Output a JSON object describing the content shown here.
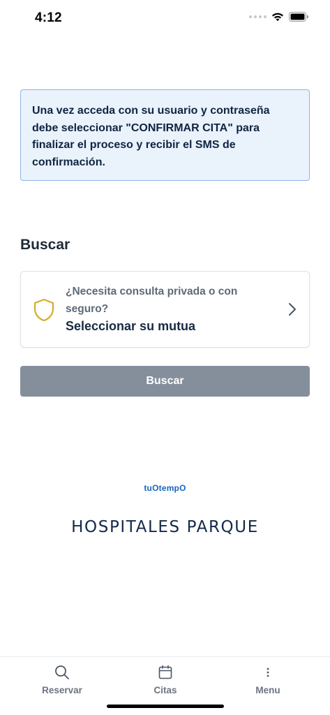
{
  "status_bar": {
    "time": "4:12"
  },
  "notice": {
    "text": "Una vez acceda con su usuario y contraseña debe seleccionar \"CONFIRMAR CITA\" para finalizar el proceso y recibir el SMS de confirmación."
  },
  "search": {
    "title": "Buscar",
    "insurance_card": {
      "question": "¿Necesita consulta privada o con seguro?",
      "action": "Seleccionar su mutua",
      "icon": "shield-icon"
    },
    "button_label": "Buscar"
  },
  "branding": {
    "powered_by": "tuOtempO",
    "hospital": "HOSPITALES PARQUE"
  },
  "tab_bar": {
    "items": [
      {
        "label": "Reservar",
        "icon": "search-icon"
      },
      {
        "label": "Citas",
        "icon": "calendar-icon"
      },
      {
        "label": "Menu",
        "icon": "more-vertical-icon"
      }
    ]
  },
  "colors": {
    "notice_bg": "#eaf2fc",
    "notice_border": "#8db3e2",
    "button_bg": "#858f9c",
    "shield": "#d4ad2b",
    "brand_blue": "#1565c0",
    "brand_navy": "#13294b"
  }
}
